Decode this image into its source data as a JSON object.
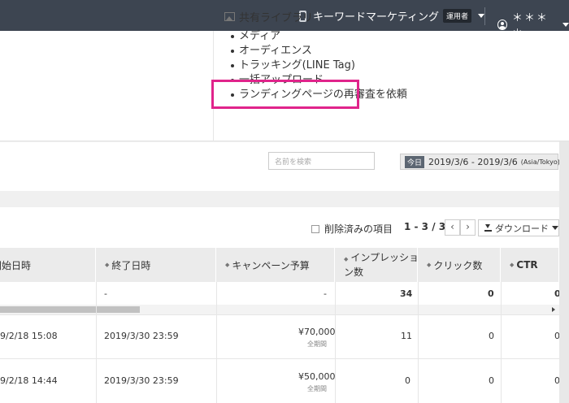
{
  "topbar": {
    "account_name": "キーワードマーケティング",
    "role_badge": "運用者",
    "user_name": "＊＊＊＊"
  },
  "library": {
    "title": "共有ライブラリ",
    "items": [
      "メディア",
      "オーディエンス",
      "トラッキング(LINE Tag)",
      "一括アップロード",
      "ランディングページの再審査を依頼"
    ]
  },
  "filter": {
    "search_placeholder": "名前を検索",
    "today_label": "今日",
    "date_range": "2019/3/6 - 2019/3/6",
    "timezone": "(Asia/Tokyo)"
  },
  "toolbar": {
    "deleted_label": "削除済みの項目",
    "page_info": "1 - 3 / 3",
    "prev": "‹",
    "next": "›",
    "download_label": "ダウンロード"
  },
  "table": {
    "headers": [
      "開始日時",
      "終了日時",
      "キャンペーン予算",
      "インプレッション数",
      "クリック数",
      "CTR"
    ],
    "header_lines": {
      "impressions_1": "インプレッショ",
      "impressions_2": "ン数"
    },
    "total_row": {
      "end": "-",
      "budget": "-",
      "impressions": "34",
      "clicks": "0",
      "ctr": "0"
    },
    "rows": [
      {
        "start": "9/2/18 15:08",
        "end": "2019/3/30 23:59",
        "budget": "¥70,000",
        "budget_sub": "全期間",
        "impressions": "11",
        "clicks": "0",
        "ctr": "0"
      },
      {
        "start": "9/2/18 14:44",
        "end": "2019/3/30 23:59",
        "budget": "¥50,000",
        "budget_sub": "全期間",
        "impressions": "0",
        "clicks": "0",
        "ctr": "0"
      }
    ]
  }
}
